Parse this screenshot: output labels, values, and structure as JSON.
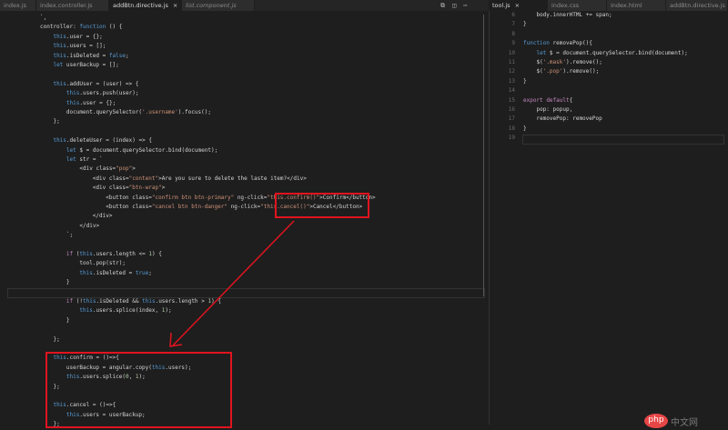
{
  "left_tabs": [
    {
      "label": "index.js",
      "active": false,
      "italic": false
    },
    {
      "label": "index.controller.js",
      "active": false,
      "italic": false
    },
    {
      "label": "addBtn.directive.js",
      "active": true,
      "italic": false
    },
    {
      "label": "list.component.js",
      "active": false,
      "italic": true
    }
  ],
  "right_tabs": [
    {
      "label": "tool.js",
      "active": true,
      "italic": false
    },
    {
      "label": "index.css",
      "active": false,
      "italic": false
    },
    {
      "label": "index.html",
      "active": false,
      "italic": false
    },
    {
      "label": "addBtn.directive.js",
      "active": false,
      "italic": false
    }
  ],
  "close_glyph": "×",
  "toolbar_icons": {
    "open_changes": "⧉",
    "split_editor": "◫",
    "more": "⋯"
  },
  "left_code": [
    "`,",
    "controller: function () {",
    "    this.user = {};",
    "    this.users = [];",
    "    this.isDeleted = false;",
    "    let userBackup = [];",
    "",
    "    this.addUser = (user) => {",
    "        this.users.push(user);",
    "        this.user = {};",
    "        document.querySelector('.username').focus();",
    "    };",
    "",
    "    this.deleteUser = (index) => {",
    "        let $ = document.querySelector.bind(document);",
    "        let str = `",
    "            <div class=\"pop\">",
    "                <div class=\"content\">Are you sure to delete the laste item?</div>",
    "                <div class=\"btn-wrap\">",
    "                    <button class=\"confirm btn btn-primary\" ng-click=\"this.confirm()\">Confirm</button>",
    "                    <button class=\"cancel btn btn-danger\" ng-click=\"this.cancel()\">Cancel</button>",
    "                </div>",
    "            </div>",
    "        `;",
    "",
    "        if (this.users.length <= 1) {",
    "            tool.pop(str);",
    "            this.isDeleted = true;",
    "        }",
    "",
    "        if (!this.isDeleted && this.users.length > 1) {",
    "            this.users.splice(index, 1);",
    "        }",
    "",
    "    };",
    "",
    "    this.confirm = ()=>{",
    "        userBackup = angular.copy(this.users);",
    "        this.users.splice(0, 1);",
    "    };",
    "",
    "    this.cancel = ()=>{",
    "        this.users = userBackup;",
    "    };"
  ],
  "right_code": [
    {
      "n": "6",
      "t": "    body.innerHTML += span;"
    },
    {
      "n": "7",
      "t": "}"
    },
    {
      "n": "8",
      "t": ""
    },
    {
      "n": "9",
      "t": "function removePop(){"
    },
    {
      "n": "10",
      "t": "    let $ = document.querySelector.bind(document);"
    },
    {
      "n": "11",
      "t": "    $('.mask').remove();"
    },
    {
      "n": "12",
      "t": "    $('.pop').remove();"
    },
    {
      "n": "13",
      "t": "}"
    },
    {
      "n": "14",
      "t": ""
    },
    {
      "n": "15",
      "t": "export default{"
    },
    {
      "n": "16",
      "t": "    pop: popup,"
    },
    {
      "n": "17",
      "t": "    removePop: removePop"
    },
    {
      "n": "18",
      "t": "}"
    },
    {
      "n": "19",
      "t": ""
    }
  ],
  "watermark": {
    "logo": "php",
    "text": "中文网"
  },
  "annotation_color": "#e0141e"
}
